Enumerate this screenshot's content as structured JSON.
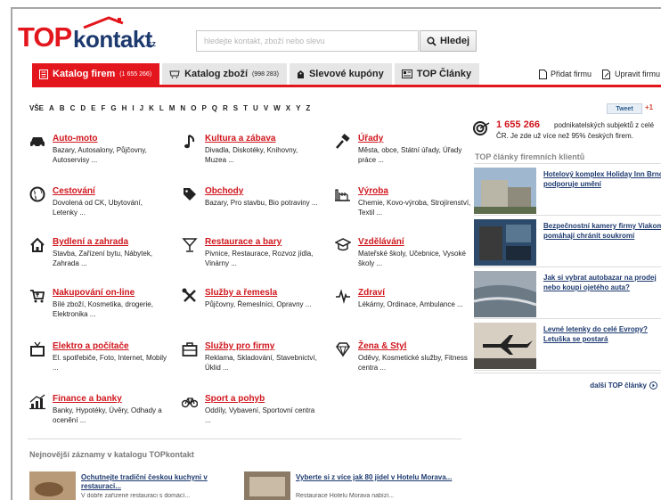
{
  "header": {
    "logo_top": "TOP",
    "logo_kontakt": "kontakt",
    "logo_cz": ".cz",
    "search_placeholder": "hledejte kontakt, zboží nebo slevu",
    "search_button": "Hledej"
  },
  "nav": {
    "tabs": [
      {
        "label": "Katalog firem",
        "count": "(1 655 266)",
        "icon": "catalog-icon"
      },
      {
        "label": "Katalog zboží",
        "count": "(998 283)",
        "icon": "cart-icon"
      },
      {
        "label": "Slevové kupóny",
        "count": "",
        "icon": "coupon-icon"
      },
      {
        "label": "TOP Články",
        "count": "",
        "icon": "articles-icon"
      }
    ],
    "right": [
      {
        "label": "Přidat firmu",
        "icon": "document-icon"
      },
      {
        "label": "Upravit firmu",
        "icon": "edit-document-icon"
      }
    ]
  },
  "alphabet": [
    "VŠE",
    "A",
    "B",
    "C",
    "D",
    "E",
    "F",
    "G",
    "H",
    "I",
    "J",
    "K",
    "L",
    "M",
    "N",
    "O",
    "P",
    "Q",
    "R",
    "S",
    "T",
    "U",
    "V",
    "W",
    "X",
    "Y",
    "Z"
  ],
  "categories": [
    {
      "title": "Auto-moto",
      "desc": "Bazary, Autosalony, Půjčovny, Autoservisy ...",
      "icon": "car-icon"
    },
    {
      "title": "Kultura a zábava",
      "desc": "Divadla, Diskotéky, Knihovny, Muzea ...",
      "icon": "music-note-icon"
    },
    {
      "title": "Úřady",
      "desc": "Města, obce, Státní úřady, Úřady práce ...",
      "icon": "gavel-icon"
    },
    {
      "title": "Cestování",
      "desc": "Dovolená od CK, Ubytování, Letenky ...",
      "icon": "globe-icon"
    },
    {
      "title": "Obchody",
      "desc": "Bazary, Pro stavbu, Bio potraviny ...",
      "icon": "tag-icon"
    },
    {
      "title": "Výroba",
      "desc": "Chemie, Kovo-výroba, Strojírenství, Textil ...",
      "icon": "factory-icon"
    },
    {
      "title": "Bydlení a zahrada",
      "desc": "Stavba, Zařízení bytu, Nábytek, Zahrada ...",
      "icon": "house-icon"
    },
    {
      "title": "Restaurace a bary",
      "desc": "Pivnice, Restaurace, Rozvoz jídla, Vinárny ...",
      "icon": "cocktail-icon"
    },
    {
      "title": "Vzdělávání",
      "desc": "Mateřské školy, Učebnice, Vysoké školy ...",
      "icon": "school-icon"
    },
    {
      "title": "Nakupování on-line",
      "desc": "Bílé zboží, Kosmetika, drogerie, Elektronika ...",
      "icon": "shopping-cart-icon"
    },
    {
      "title": "Služby a řemesla",
      "desc": "Půjčovny, Řemeslníci, Opravny ...",
      "icon": "tools-icon"
    },
    {
      "title": "Zdraví",
      "desc": "Lékárny, Ordinace, Ambulance ...",
      "icon": "heartbeat-icon"
    },
    {
      "title": "Elektro a počítače",
      "desc": "El. spotřebiče, Foto, Internet, Mobily ...",
      "icon": "tv-icon"
    },
    {
      "title": "Služby pro firmy",
      "desc": "Reklama, Skladování, Stavebnictví, Úklid ...",
      "icon": "briefcase-icon"
    },
    {
      "title": "Žena & Styl",
      "desc": "Oděvy, Kosmetické služby, Fitness centra ...",
      "icon": "diamond-icon"
    },
    {
      "title": "Finance a banky",
      "desc": "Banky, Hypotéky, Úvěry, Odhady a ocenění ...",
      "icon": "finance-chart-icon"
    },
    {
      "title": "Sport a pohyb",
      "desc": "Oddíly, Vybavení, Sportovní centra ...",
      "icon": "bicycle-icon"
    }
  ],
  "social": {
    "tweet": "Tweet",
    "gplus": "+1"
  },
  "stats": {
    "number": "1 655 266",
    "text1": "podnikatelských subjektů z celé",
    "text2": "ČR. Je zde už více než 95% českých firem."
  },
  "articles": {
    "heading": "TOP články firemních klientů",
    "items": [
      {
        "title": "Hotelový komplex Holiday Inn Brno podporuje umění"
      },
      {
        "title": "Bezpečnostní kamery firmy Viakom pomáhají chránit soukromí"
      },
      {
        "title": "Jak si vybrat autobazar na prodej nebo koupi ojetého auta?"
      },
      {
        "title": "Levné letenky do celé Evropy? Letuška se postará"
      }
    ],
    "more": "další TOP články"
  },
  "newest": {
    "heading": "Nejnovější záznamy v katalogu TOPkontakt",
    "items": [
      {
        "title": "Ochutnejte tradiční českou kuchyni v restauraci...",
        "desc": "V dobře zařízené restauraci s domácí..."
      },
      {
        "title": "Vyberte si z více jak 80 jídel v Hotelu Morava...",
        "desc": "Restaurace Hotelu Morava nabízí..."
      }
    ]
  },
  "colors": {
    "brand_red": "#e3161d",
    "link_blue": "#1d3a6f"
  }
}
